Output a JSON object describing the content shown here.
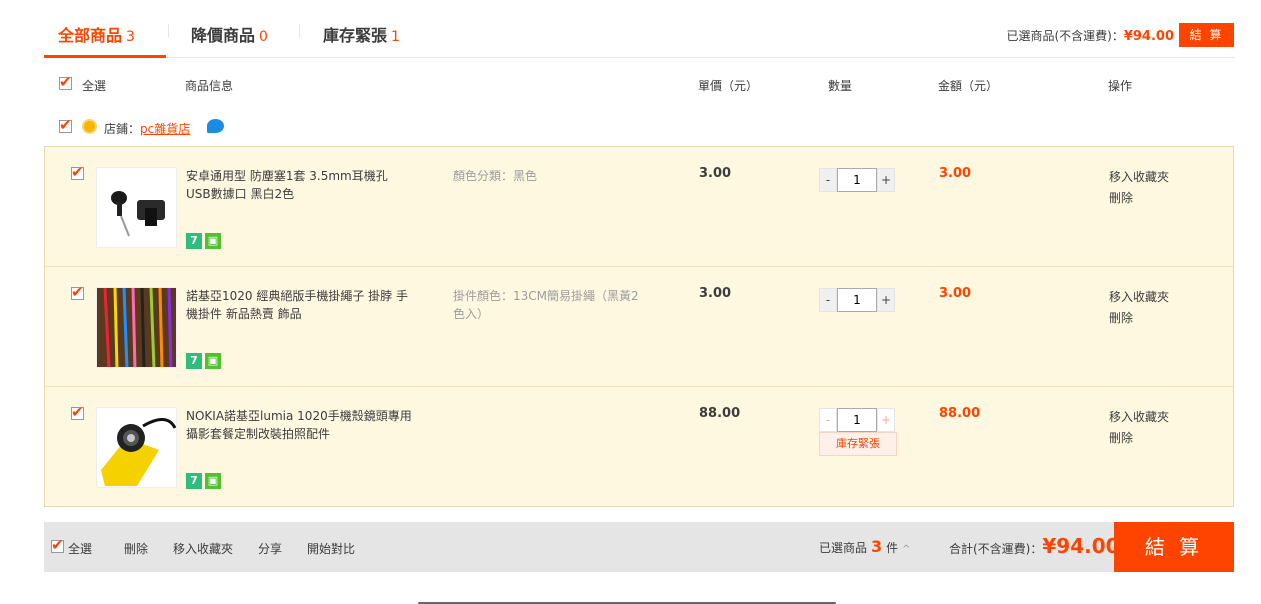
{
  "tabs": [
    {
      "label": "全部商品",
      "count": "3"
    },
    {
      "label": "降價商品",
      "count": "0"
    },
    {
      "label": "庫存緊張",
      "count": "1"
    }
  ],
  "top_summary": {
    "label": "已選商品(不含運費)：",
    "amount": "¥94.00",
    "checkout": "結 算"
  },
  "header": {
    "select_all": "全選",
    "product_info": "商品信息",
    "unit_price": "單價（元）",
    "quantity": "數量",
    "amount": "金額（元）",
    "actions": "操作"
  },
  "shop": {
    "prefix": "店鋪：",
    "name": "pc雜貨店"
  },
  "colors": {
    "accent": "#ff4400",
    "row_bg": "#fff8e1"
  },
  "items": [
    {
      "title": "安卓通用型 防塵塞1套 3.5mm耳機孔 USB數據口 黑白2色",
      "sku": "顏色分類：黑色",
      "price": "3.00",
      "qty": "1",
      "minus": "-",
      "plus": "+",
      "sum": "3.00",
      "op_fav": "移入收藏夾",
      "op_del": "刪除"
    },
    {
      "title": "諾基亞1020 經典絕版手機掛繩子 掛脖 手機掛件 新品熱賣 飾品",
      "sku": "掛件顏色：13CM簡易掛繩（黑黃2色入）",
      "price": "3.00",
      "qty": "1",
      "minus": "-",
      "plus": "+",
      "sum": "3.00",
      "op_fav": "移入收藏夾",
      "op_del": "刪除"
    },
    {
      "title": "NOKIA諾基亞lumia 1020手機殼鏡頭專用攝影套餐定制改裝拍照配件",
      "sku": "",
      "price": "88.00",
      "qty": "1",
      "minus": "-",
      "plus": "+",
      "low_stock": "庫存緊張",
      "sum": "88.00",
      "op_fav": "移入收藏夾",
      "op_del": "刪除"
    }
  ],
  "badge_seven": "7",
  "footer": {
    "select_all": "全選",
    "delete": "刪除",
    "move_fav": "移入收藏夾",
    "share": "分享",
    "compare": "開始對比",
    "selected_label": "已選商品",
    "selected_count": "3",
    "selected_unit": "件",
    "caret": "^",
    "total_label": "合計(不含運費)：",
    "total_amount": "¥94.00",
    "checkout": "結 算"
  }
}
